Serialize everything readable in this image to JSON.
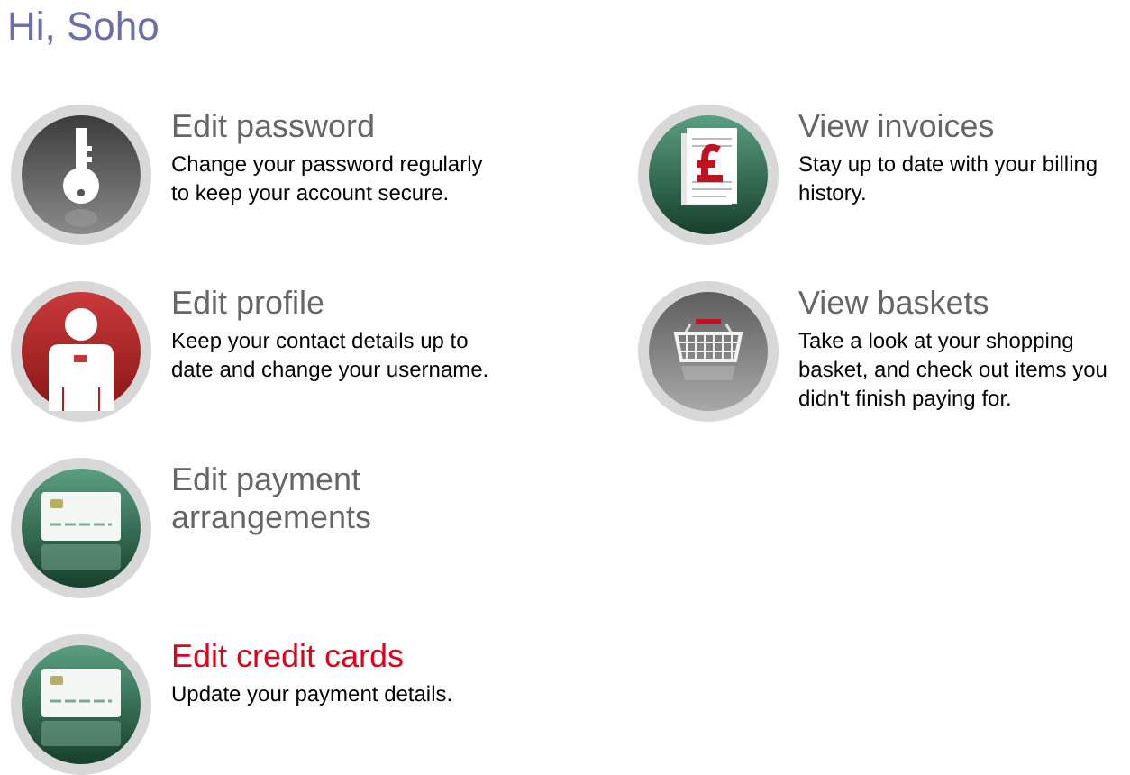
{
  "greeting": "Hi, Soho",
  "columns": [
    [
      {
        "kind": "key",
        "title": "Edit password",
        "description": "Change your password regularly to keep your account secure.",
        "highlighted": false
      },
      {
        "kind": "profile",
        "title": "Edit profile",
        "description": "Keep your contact details up to date and change your username.",
        "highlighted": false
      },
      {
        "kind": "card",
        "title": "Edit payment arrangements",
        "highlighted": false
      },
      {
        "kind": "card",
        "title": "Edit credit cards",
        "description": "Update your payment details.",
        "highlighted": true
      }
    ],
    [
      {
        "kind": "invoice",
        "title": "View invoices",
        "description": "Stay up to date with your billing history.",
        "highlighted": false
      },
      {
        "kind": "basket",
        "title": "View baskets",
        "description": "Take a look at your shopping basket, and check out items you didn't finish paying for.",
        "highlighted": false
      }
    ]
  ]
}
